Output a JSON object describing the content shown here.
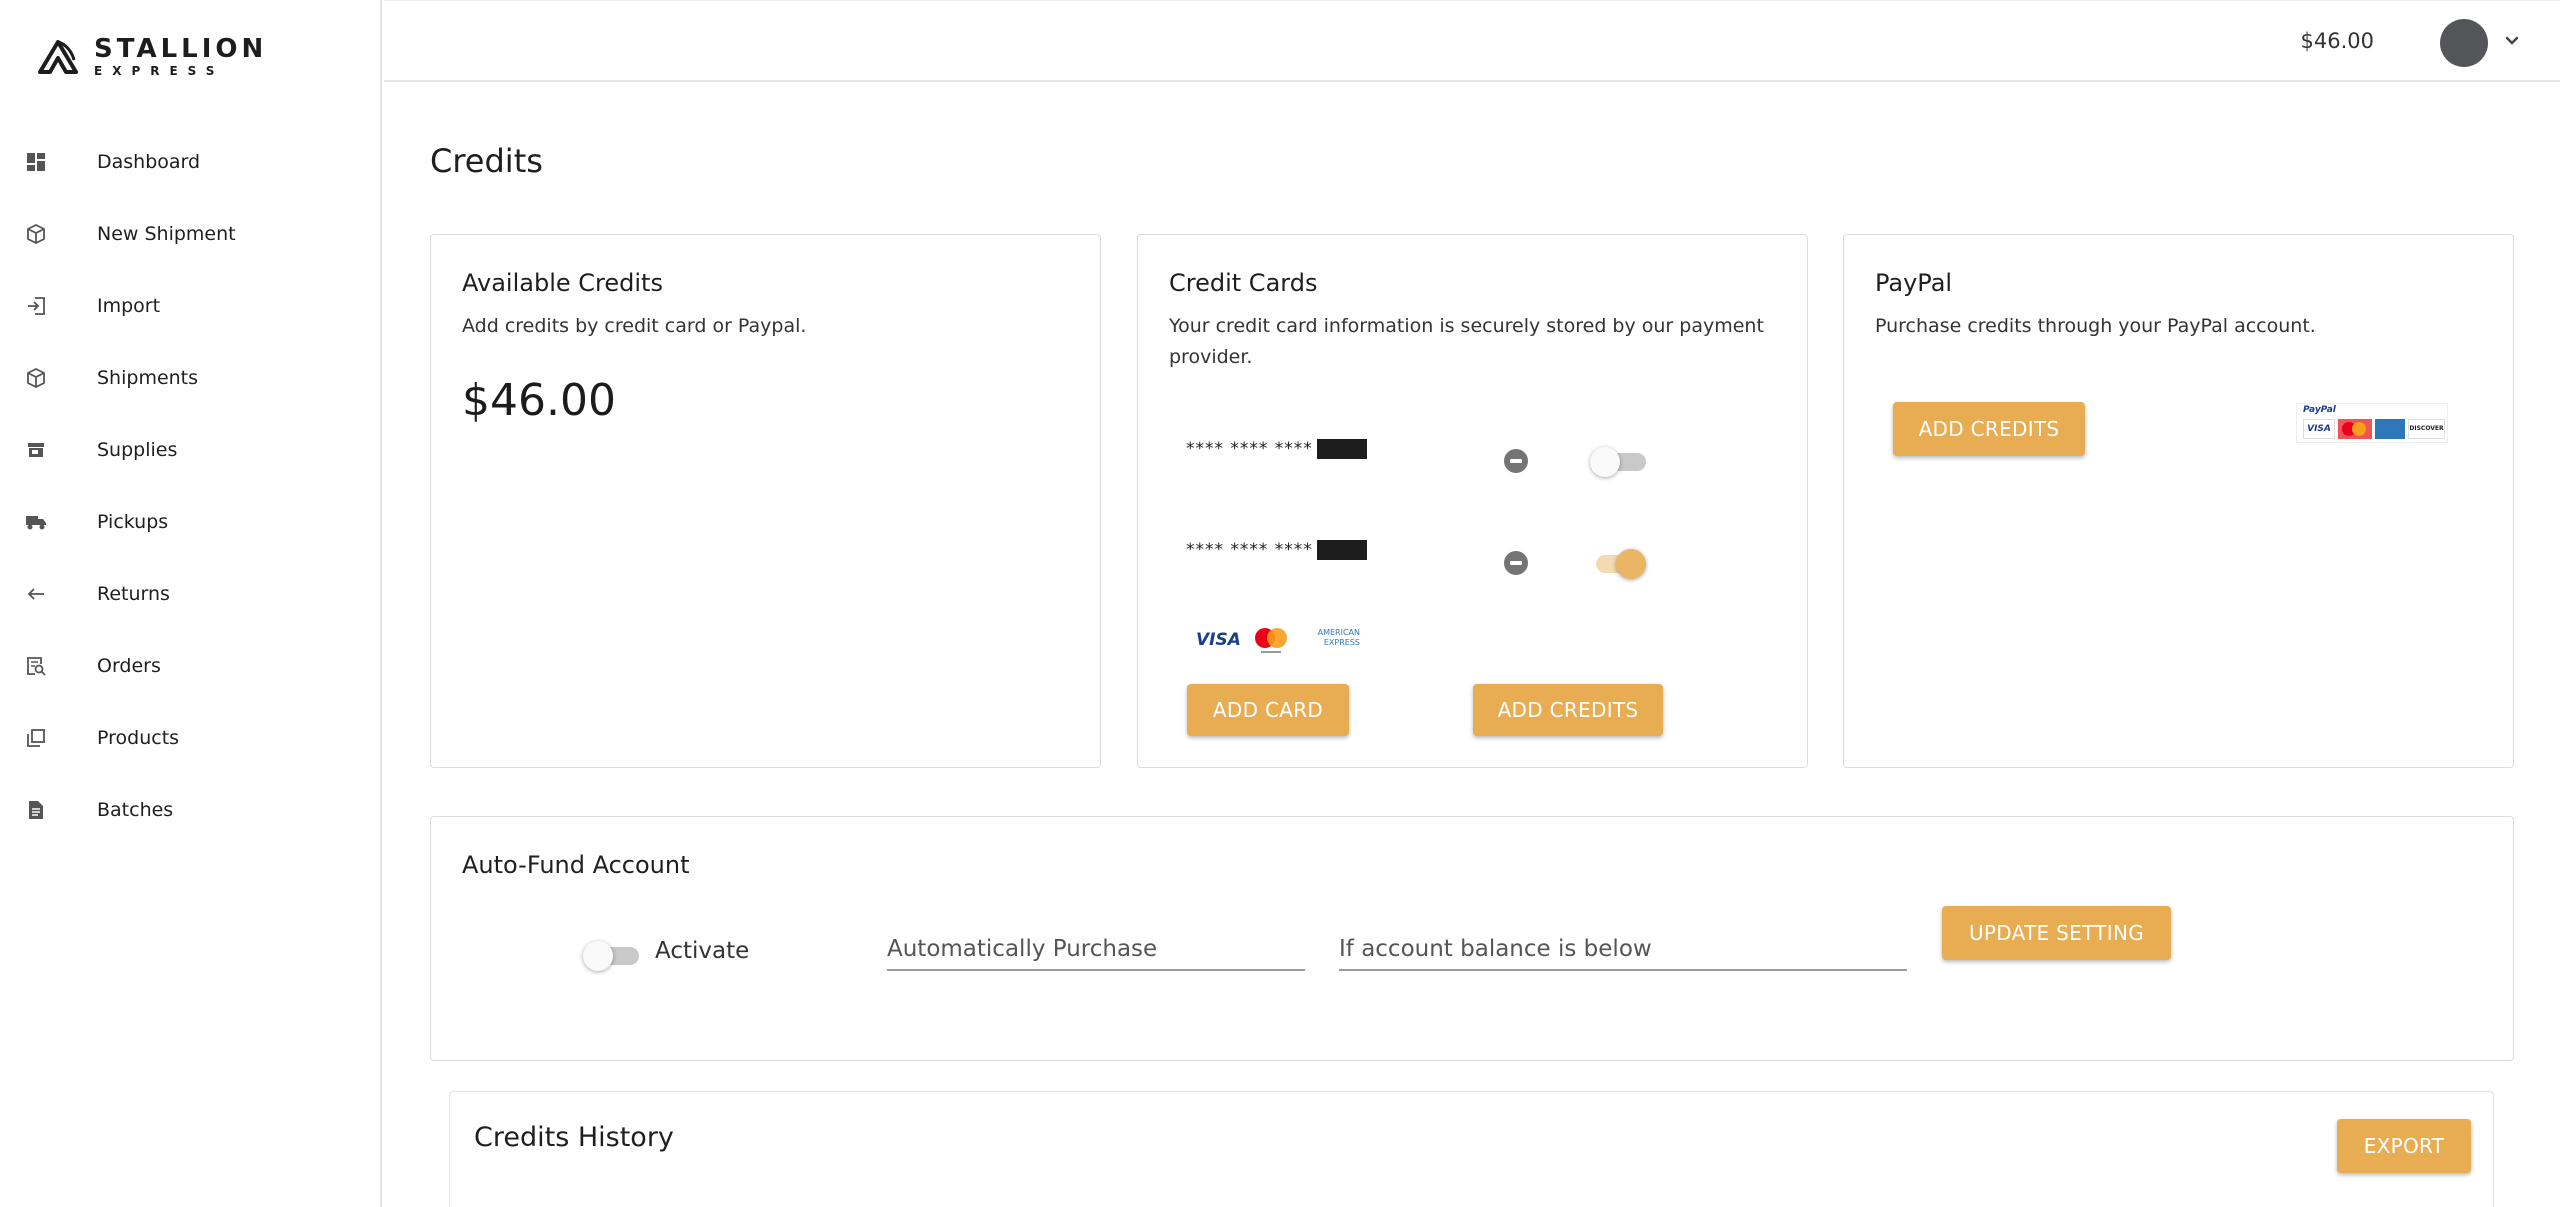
{
  "brand": {
    "name": "STALLION",
    "sub": "EXPRESS"
  },
  "sidebar": {
    "items": [
      {
        "label": "Dashboard",
        "icon": "dashboard-icon"
      },
      {
        "label": "New Shipment",
        "icon": "package-icon"
      },
      {
        "label": "Import",
        "icon": "import-icon"
      },
      {
        "label": "Shipments",
        "icon": "package-icon"
      },
      {
        "label": "Supplies",
        "icon": "store-icon"
      },
      {
        "label": "Pickups",
        "icon": "truck-icon"
      },
      {
        "label": "Returns",
        "icon": "arrow-left-icon"
      },
      {
        "label": "Orders",
        "icon": "order-search-icon"
      },
      {
        "label": "Products",
        "icon": "products-icon"
      },
      {
        "label": "Batches",
        "icon": "document-icon"
      }
    ]
  },
  "header": {
    "balance": "$46.00"
  },
  "page": {
    "title": "Credits"
  },
  "available": {
    "title": "Available Credits",
    "description": "Add credits by credit card or Paypal.",
    "amount": "$46.00"
  },
  "credit_cards": {
    "title": "Credit Cards",
    "description_line1": "Your credit card information is securely stored by our payment",
    "description_line2": "provider.",
    "cards": [
      {
        "masked": "**** **** ****",
        "enabled": false
      },
      {
        "masked": "**** **** ****",
        "enabled": true
      }
    ],
    "logos": {
      "visa": "VISA",
      "amex_line1": "AMERICAN",
      "amex_line2": "EXPRESS"
    },
    "add_card_label": "ADD CARD",
    "add_credits_label": "ADD CREDITS"
  },
  "paypal": {
    "title": "PayPal",
    "description": "Purchase credits through your PayPal account.",
    "add_credits_label": "ADD CREDITS",
    "badge": {
      "paypal": "PayPal",
      "visa": "VISA",
      "discover": "DISCOVER"
    }
  },
  "autofund": {
    "title": "Auto-Fund Account",
    "activate_label": "Activate",
    "activated": false,
    "purchase_placeholder": "Automatically Purchase",
    "threshold_placeholder": "If account balance is below",
    "update_label": "UPDATE SETTING"
  },
  "history": {
    "title": "Credits History",
    "export_label": "EXPORT"
  },
  "colors": {
    "accent": "#e8ad52",
    "text": "#1f1f1f",
    "border": "#dcdcdc"
  }
}
